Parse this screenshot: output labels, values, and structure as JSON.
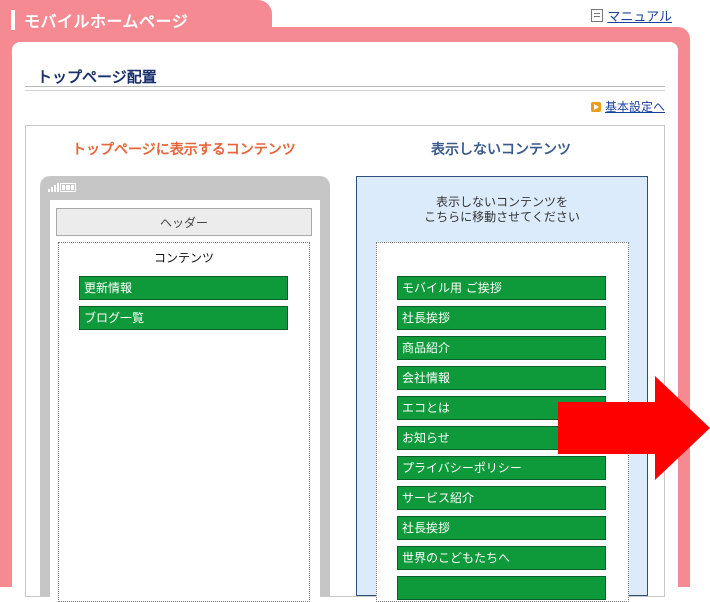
{
  "header": {
    "title": "モバイルホームページ",
    "manual_link": "マニュアル"
  },
  "section": {
    "title": "トップページ配置",
    "settings_link": "基本設定へ"
  },
  "left_column": {
    "title": "トップページに表示するコンテンツ",
    "header_label": "ヘッダー",
    "contents_label": "コンテンツ",
    "items": [
      "更新情報",
      "ブログ一覧"
    ]
  },
  "right_column": {
    "title": "表示しないコンテンツ",
    "instruction_line1": "表示しないコンテンツを",
    "instruction_line2": "こちらに移動させてください",
    "items": [
      "モバイル用 ご挨拶",
      "社長挨拶",
      "商品紹介",
      "会社情報",
      "エコとは",
      "お知らせ",
      "プライバシーポリシー",
      "サービス紹介",
      "社長挨拶",
      "世界のこどもたちへ",
      ""
    ]
  },
  "colors": {
    "pink": "#f58a92",
    "green": "#0e9a3a",
    "orange_title": "#e8643a",
    "blue_title": "#3a5a8c",
    "arrow": "#ff0000"
  },
  "icons": [
    "manual-document-icon",
    "orange-arrow-icon",
    "signal-icon",
    "battery-icon",
    "red-arrow-icon"
  ]
}
